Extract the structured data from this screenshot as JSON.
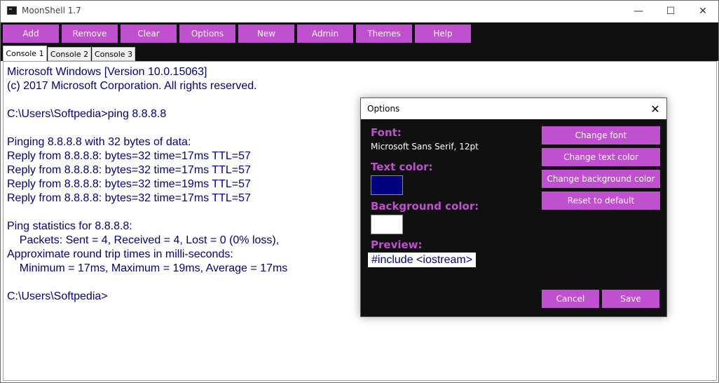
{
  "window": {
    "title": "MoonShell 1.7",
    "controls": {
      "minimize": "—",
      "maximize": "☐",
      "close": "✕"
    }
  },
  "menu": {
    "items": [
      {
        "label": "Add"
      },
      {
        "label": "Remove"
      },
      {
        "label": "Clear"
      },
      {
        "label": "Options"
      },
      {
        "label": "New"
      },
      {
        "label": "Admin"
      },
      {
        "label": "Themes"
      },
      {
        "label": "Help"
      }
    ]
  },
  "tabs": [
    {
      "label": "Console 1",
      "active": true
    },
    {
      "label": "Console 2",
      "active": false
    },
    {
      "label": "Console 3",
      "active": false
    }
  ],
  "console": {
    "lines": [
      "Microsoft Windows [Version 10.0.15063]",
      "(c) 2017 Microsoft Corporation. All rights reserved.",
      "",
      "C:\\Users\\Softpedia>ping 8.8.8.8",
      "",
      "Pinging 8.8.8.8 with 32 bytes of data:",
      "Reply from 8.8.8.8: bytes=32 time=17ms TTL=57",
      "Reply from 8.8.8.8: bytes=32 time=17ms TTL=57",
      "Reply from 8.8.8.8: bytes=32 time=19ms TTL=57",
      "Reply from 8.8.8.8: bytes=32 time=17ms TTL=57",
      "",
      "Ping statistics for 8.8.8.8:",
      "    Packets: Sent = 4, Received = 4, Lost = 0 (0% loss),",
      "Approximate round trip times in milli-seconds:",
      "    Minimum = 17ms, Maximum = 19ms, Average = 17ms",
      "",
      "C:\\Users\\Softpedia>"
    ]
  },
  "options_dialog": {
    "title": "Options",
    "close": "✕",
    "font_label": "Font:",
    "font_value": "Microsoft Sans Serif, 12pt",
    "text_color_label": "Text color:",
    "text_color": "#000080",
    "background_color_label": "Background color:",
    "background_color": "#ffffff",
    "preview_label": "Preview:",
    "preview_text": "#include <iostream>",
    "buttons": {
      "change_font": "Change font",
      "change_text_color": "Change text color",
      "change_background_color": "Change background color",
      "reset_to_default": "Reset to default",
      "cancel": "Cancel",
      "save": "Save"
    }
  },
  "colors": {
    "accent": "#c050d0",
    "toolbar_bg": "#101010",
    "console_text": "#000080"
  }
}
